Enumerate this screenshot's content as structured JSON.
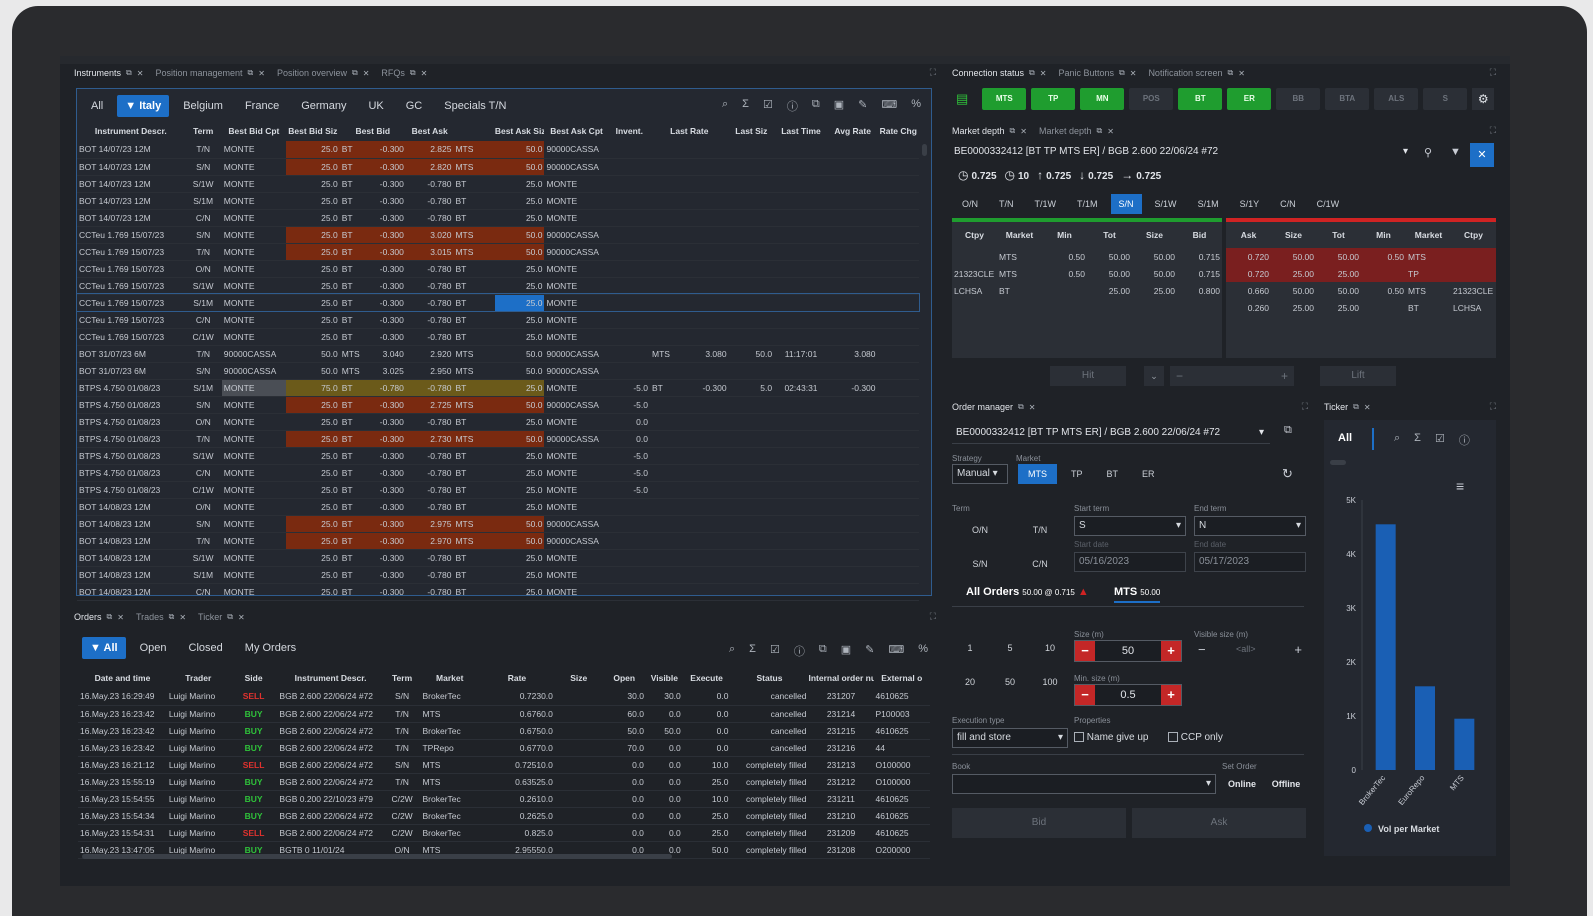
{
  "instruments_pane": {
    "tabs": [
      "Instruments",
      "Position management",
      "Position overview",
      "RFQs"
    ],
    "filters": [
      "All",
      "Italy",
      "Belgium",
      "France",
      "Germany",
      "UK",
      "GC",
      "Specials T/N"
    ],
    "columns": [
      "Instrument Descr.",
      "Term",
      "Best Bid Cpt",
      "Best Bid Siz",
      "Best Bid",
      "Best Ask",
      "Best Ask Siz",
      "Best Ask Cpt",
      "Invent.",
      "Last Rate",
      "Last Siz",
      "Last Time",
      "Avg Rate",
      "Rate Chg"
    ],
    "rows": [
      [
        "BOT 14/07/23 12M",
        "T/N",
        "MONTE",
        "25.0",
        "BT",
        "-0.300",
        "2.825",
        "MTS",
        "50.0",
        "90000CASSA",
        "",
        "",
        "",
        "",
        "",
        "",
        "h"
      ],
      [
        "BOT 14/07/23 12M",
        "S/N",
        "MONTE",
        "25.0",
        "BT",
        "-0.300",
        "2.820",
        "MTS",
        "50.0",
        "90000CASSA",
        "",
        "",
        "",
        "",
        "",
        "",
        "h"
      ],
      [
        "BOT 14/07/23 12M",
        "S/1W",
        "MONTE",
        "25.0",
        "BT",
        "-0.300",
        "-0.780",
        "BT",
        "25.0",
        "MONTE",
        "",
        "",
        "",
        "",
        "",
        "",
        ""
      ],
      [
        "BOT 14/07/23 12M",
        "S/1M",
        "MONTE",
        "25.0",
        "BT",
        "-0.300",
        "-0.780",
        "BT",
        "25.0",
        "MONTE",
        "",
        "",
        "",
        "",
        "",
        "",
        ""
      ],
      [
        "BOT 14/07/23 12M",
        "C/N",
        "MONTE",
        "25.0",
        "BT",
        "-0.300",
        "-0.780",
        "BT",
        "25.0",
        "MONTE",
        "",
        "",
        "",
        "",
        "",
        "",
        ""
      ],
      [
        "CCTeu 1.769 15/07/23",
        "S/N",
        "MONTE",
        "25.0",
        "BT",
        "-0.300",
        "3.020",
        "MTS",
        "50.0",
        "90000CASSA",
        "",
        "",
        "",
        "",
        "",
        "",
        "h"
      ],
      [
        "CCTeu 1.769 15/07/23",
        "T/N",
        "MONTE",
        "25.0",
        "BT",
        "-0.300",
        "3.015",
        "MTS",
        "50.0",
        "90000CASSA",
        "",
        "",
        "",
        "",
        "",
        "",
        "h"
      ],
      [
        "CCTeu 1.769 15/07/23",
        "O/N",
        "MONTE",
        "25.0",
        "BT",
        "-0.300",
        "-0.780",
        "BT",
        "25.0",
        "MONTE",
        "",
        "",
        "",
        "",
        "",
        "",
        ""
      ],
      [
        "CCTeu 1.769 15/07/23",
        "S/1W",
        "MONTE",
        "25.0",
        "BT",
        "-0.300",
        "-0.780",
        "BT",
        "25.0",
        "MONTE",
        "",
        "",
        "",
        "",
        "",
        "",
        ""
      ],
      [
        "CCTeu 1.769 15/07/23",
        "S/1M",
        "MONTE",
        "25.0",
        "BT",
        "-0.300",
        "-0.780",
        "BT",
        "25.0",
        "MONTE",
        "",
        "",
        "",
        "",
        "",
        "",
        "s"
      ],
      [
        "CCTeu 1.769 15/07/23",
        "C/N",
        "MONTE",
        "25.0",
        "BT",
        "-0.300",
        "-0.780",
        "BT",
        "25.0",
        "MONTE",
        "",
        "",
        "",
        "",
        "",
        "",
        ""
      ],
      [
        "CCTeu 1.769 15/07/23",
        "C/1W",
        "MONTE",
        "25.0",
        "BT",
        "-0.300",
        "-0.780",
        "BT",
        "25.0",
        "MONTE",
        "",
        "",
        "",
        "",
        "",
        "",
        ""
      ],
      [
        "BOT 31/07/23 6M",
        "T/N",
        "90000CASSA",
        "50.0",
        "MTS",
        "3.040",
        "2.920",
        "MTS",
        "50.0",
        "90000CASSA",
        "",
        "MTS",
        "3.080",
        "50.0",
        "11:17:01",
        "3.080",
        ""
      ],
      [
        "BOT 31/07/23 6M",
        "S/N",
        "90000CASSA",
        "50.0",
        "MTS",
        "3.025",
        "2.950",
        "MTS",
        "50.0",
        "90000CASSA",
        "",
        "",
        "",
        "",
        "",
        "",
        ""
      ],
      [
        "BTPS 4.750 01/08/23",
        "S/1M",
        "MONTE",
        "75.0",
        "BT",
        "-0.780",
        "-0.780",
        "BT",
        "25.0",
        "MONTE",
        "-5.0",
        "BT",
        "-0.300",
        "5.0",
        "02:43:31",
        "-0.300",
        "y"
      ],
      [
        "BTPS 4.750 01/08/23",
        "S/N",
        "MONTE",
        "25.0",
        "BT",
        "-0.300",
        "2.725",
        "MTS",
        "50.0",
        "90000CASSA",
        "-5.0",
        "",
        "",
        "",
        "",
        "",
        "h"
      ],
      [
        "BTPS 4.750 01/08/23",
        "O/N",
        "MONTE",
        "25.0",
        "BT",
        "-0.300",
        "-0.780",
        "BT",
        "25.0",
        "MONTE",
        "0.0",
        "",
        "",
        "",
        "",
        "",
        ""
      ],
      [
        "BTPS 4.750 01/08/23",
        "T/N",
        "MONTE",
        "25.0",
        "BT",
        "-0.300",
        "2.730",
        "MTS",
        "50.0",
        "90000CASSA",
        "0.0",
        "",
        "",
        "",
        "",
        "",
        "h"
      ],
      [
        "BTPS 4.750 01/08/23",
        "S/1W",
        "MONTE",
        "25.0",
        "BT",
        "-0.300",
        "-0.780",
        "BT",
        "25.0",
        "MONTE",
        "-5.0",
        "",
        "",
        "",
        "",
        "",
        ""
      ],
      [
        "BTPS 4.750 01/08/23",
        "C/N",
        "MONTE",
        "25.0",
        "BT",
        "-0.300",
        "-0.780",
        "BT",
        "25.0",
        "MONTE",
        "-5.0",
        "",
        "",
        "",
        "",
        "",
        ""
      ],
      [
        "BTPS 4.750 01/08/23",
        "C/1W",
        "MONTE",
        "25.0",
        "BT",
        "-0.300",
        "-0.780",
        "BT",
        "25.0",
        "MONTE",
        "-5.0",
        "",
        "",
        "",
        "",
        "",
        ""
      ],
      [
        "BOT 14/08/23 12M",
        "O/N",
        "MONTE",
        "25.0",
        "BT",
        "-0.300",
        "-0.780",
        "BT",
        "25.0",
        "MONTE",
        "",
        "",
        "",
        "",
        "",
        "",
        ""
      ],
      [
        "BOT 14/08/23 12M",
        "S/N",
        "MONTE",
        "25.0",
        "BT",
        "-0.300",
        "2.975",
        "MTS",
        "50.0",
        "90000CASSA",
        "",
        "",
        "",
        "",
        "",
        "",
        "h"
      ],
      [
        "BOT 14/08/23 12M",
        "T/N",
        "MONTE",
        "25.0",
        "BT",
        "-0.300",
        "2.970",
        "MTS",
        "50.0",
        "90000CASSA",
        "",
        "",
        "",
        "",
        "",
        "",
        "h"
      ],
      [
        "BOT 14/08/23 12M",
        "S/1W",
        "MONTE",
        "25.0",
        "BT",
        "-0.300",
        "-0.780",
        "BT",
        "25.0",
        "MONTE",
        "",
        "",
        "",
        "",
        "",
        "",
        ""
      ],
      [
        "BOT 14/08/23 12M",
        "S/1M",
        "MONTE",
        "25.0",
        "BT",
        "-0.300",
        "-0.780",
        "BT",
        "25.0",
        "MONTE",
        "",
        "",
        "",
        "",
        "",
        "",
        ""
      ],
      [
        "BOT 14/08/23 12M",
        "C/N",
        "MONTE",
        "25.0",
        "BT",
        "-0.300",
        "-0.780",
        "BT",
        "25.0",
        "MONTE",
        "",
        "",
        "",
        "",
        "",
        "",
        ""
      ]
    ]
  },
  "orders_pane": {
    "tabs": [
      "Orders",
      "Trades",
      "Ticker"
    ],
    "filters": [
      "All",
      "Open",
      "Closed",
      "My Orders"
    ],
    "columns": [
      "Date and time",
      "Trader",
      "Side",
      "Instrument Descr.",
      "Term",
      "Market",
      "Rate",
      "Size",
      "Open",
      "Visible",
      "Execute",
      "Status",
      "Internal order nu",
      "External o"
    ],
    "rows": [
      [
        "16.May.23 16:29:49",
        "Luigi Marino",
        "SELL",
        "BGB 2.600 22/06/24 #72",
        "S/N",
        "BrokerTec",
        "0.7230.0",
        "",
        "30.0",
        "30.0",
        "0.0",
        "cancelled",
        "231207",
        "4610625"
      ],
      [
        "16.May.23 16:23:42",
        "Luigi Marino",
        "BUY",
        "BGB 2.600 22/06/24 #72",
        "T/N",
        "MTS",
        "0.6760.0",
        "",
        "60.0",
        "0.0",
        "0.0",
        "cancelled",
        "231214",
        "P100003"
      ],
      [
        "16.May.23 16:23:42",
        "Luigi Marino",
        "BUY",
        "BGB 2.600 22/06/24 #72",
        "T/N",
        "BrokerTec",
        "0.6750.0",
        "",
        "50.0",
        "50.0",
        "0.0",
        "cancelled",
        "231215",
        "4610625"
      ],
      [
        "16.May.23 16:23:42",
        "Luigi Marino",
        "BUY",
        "BGB 2.600 22/06/24 #72",
        "T/N",
        "TPRepo",
        "0.6770.0",
        "",
        "70.0",
        "0.0",
        "0.0",
        "cancelled",
        "231216",
        "44"
      ],
      [
        "16.May.23 16:21:12",
        "Luigi Marino",
        "SELL",
        "BGB 2.600 22/06/24 #72",
        "S/N",
        "MTS",
        "0.72510.0",
        "",
        "0.0",
        "0.0",
        "10.0",
        "completely filled",
        "231213",
        "O100000"
      ],
      [
        "16.May.23 15:55:19",
        "Luigi Marino",
        "BUY",
        "BGB 2.600 22/06/24 #72",
        "T/N",
        "MTS",
        "0.63525.0",
        "",
        "0.0",
        "0.0",
        "25.0",
        "completely filled",
        "231212",
        "O100000"
      ],
      [
        "16.May.23 15:54:55",
        "Luigi Marino",
        "BUY",
        "BGB 0.200 22/10/23 #79",
        "C/2W",
        "BrokerTec",
        "0.2610.0",
        "",
        "0.0",
        "0.0",
        "10.0",
        "completely filled",
        "231211",
        "4610625"
      ],
      [
        "16.May.23 15:54:34",
        "Luigi Marino",
        "BUY",
        "BGB 2.600 22/06/24 #72",
        "C/2W",
        "BrokerTec",
        "0.2625.0",
        "",
        "0.0",
        "0.0",
        "25.0",
        "completely filled",
        "231210",
        "4610625"
      ],
      [
        "16.May.23 15:54:31",
        "Luigi Marino",
        "SELL",
        "BGB 2.600 22/06/24 #72",
        "C/2W",
        "BrokerTec",
        "0.825.0",
        "",
        "0.0",
        "0.0",
        "25.0",
        "completely filled",
        "231209",
        "4610625"
      ],
      [
        "16.May.23 13:47:05",
        "Luigi Marino",
        "BUY",
        "BGTB 0 11/01/24",
        "O/N",
        "MTS",
        "2.95550.0",
        "",
        "0.0",
        "0.0",
        "50.0",
        "completely filled",
        "231208",
        "O200000"
      ]
    ]
  },
  "connection_pane": {
    "tabs": [
      "Connection status",
      "Panic Buttons",
      "Notification screen"
    ],
    "buttons": [
      {
        "label": "MTS",
        "on": true
      },
      {
        "label": "TP",
        "on": true
      },
      {
        "label": "MN",
        "on": true
      },
      {
        "label": "POS",
        "on": false
      },
      {
        "label": "BT",
        "on": true
      },
      {
        "label": "ER",
        "on": true
      },
      {
        "label": "BB",
        "on": false
      },
      {
        "label": "BTA",
        "on": false
      },
      {
        "label": "ALS",
        "on": false
      },
      {
        "label": "S",
        "on": false
      }
    ]
  },
  "market_depth": {
    "tabs": [
      "Market depth",
      "Market depth"
    ],
    "instrument": "BE0000332412 [BT TP MTS ER] / BGB 2.600 22/06/24 #72",
    "stats": [
      "0.725",
      "10",
      "0.725",
      "0.725",
      "0.725"
    ],
    "terms": [
      "O/N",
      "T/N",
      "T/1W",
      "T/1M",
      "S/N",
      "S/1W",
      "S/1M",
      "S/1Y",
      "C/N",
      "C/1W"
    ],
    "selected_term": "S/N",
    "bid_columns": [
      "Ctpy",
      "Market",
      "Min",
      "Tot",
      "Size",
      "Bid"
    ],
    "ask_columns": [
      "Ask",
      "Size",
      "Tot",
      "Min",
      "Market",
      "Ctpy"
    ],
    "bid_rows": [
      [
        "",
        "MTS",
        "0.50",
        "50.00",
        "50.00",
        "0.715"
      ],
      [
        "21323CLE",
        "MTS",
        "0.50",
        "50.00",
        "50.00",
        "0.715"
      ],
      [
        "LCHSA",
        "BT",
        "",
        "25.00",
        "25.00",
        "0.800"
      ]
    ],
    "ask_rows": [
      [
        "0.720",
        "50.00",
        "50.00",
        "0.50",
        "MTS",
        ""
      ],
      [
        "0.720",
        "25.00",
        "25.00",
        "",
        "TP",
        ""
      ],
      [
        "0.660",
        "50.00",
        "50.00",
        "0.50",
        "MTS",
        "21323CLE"
      ],
      [
        "0.260",
        "25.00",
        "25.00",
        "",
        "BT",
        "LCHSA"
      ]
    ],
    "hit_label": "Hit",
    "lift_label": "Lift"
  },
  "order_manager": {
    "tab": "Order manager",
    "instrument": "BE0000332412 [BT TP MTS ER] / BGB 2.600 22/06/24 #72",
    "strategy_label": "Strategy",
    "strategy_value": "Manual",
    "market_label": "Market",
    "markets": [
      "MTS",
      "TP",
      "BT",
      "ER"
    ],
    "term_label": "Term",
    "terms": [
      "O/N",
      "T/N",
      "S/N",
      "C/N"
    ],
    "start_term_label": "Start term",
    "start_term": "S",
    "end_term_label": "End term",
    "end_term": "N",
    "start_date_label": "Start date",
    "start_date": "05/16/2023",
    "end_date_label": "End date",
    "end_date": "05/17/2023",
    "all_orders_label": "All Orders",
    "all_orders_info": "50.00 @ 0.715",
    "mts_label": "MTS",
    "mts_info": "50.00",
    "quick_sizes": [
      "1",
      "5",
      "10",
      "20",
      "50",
      "100"
    ],
    "size_label": "Size (m)",
    "size_value": "50",
    "visible_size_label": "Visible size (m)",
    "visible_size_placeholder": "<all>",
    "min_size_label": "Min. size (m)",
    "min_size_value": "0.5",
    "exec_type_label": "Execution type",
    "exec_type_value": "fill and store",
    "properties_label": "Properties",
    "name_give_up": "Name give up",
    "ccp_only": "CCP only",
    "book_label": "Book",
    "set_order_label": "Set Order",
    "online": "Online",
    "offline": "Offline",
    "bid_label": "Bid",
    "ask_label": "Ask"
  },
  "ticker": {
    "tab": "Ticker",
    "filter": "All",
    "legend": "Vol per Market"
  },
  "chart_data": {
    "type": "bar",
    "categories": [
      "BrokerTec",
      "EuroRepo",
      "MTS"
    ],
    "values": [
      4550,
      1550,
      950
    ],
    "ylim": [
      0,
      5000
    ],
    "yticks": [
      "0",
      "1K",
      "2K",
      "3K",
      "4K",
      "5K"
    ],
    "legend": [
      "Vol per Market"
    ],
    "color": "#1a5fb4"
  }
}
